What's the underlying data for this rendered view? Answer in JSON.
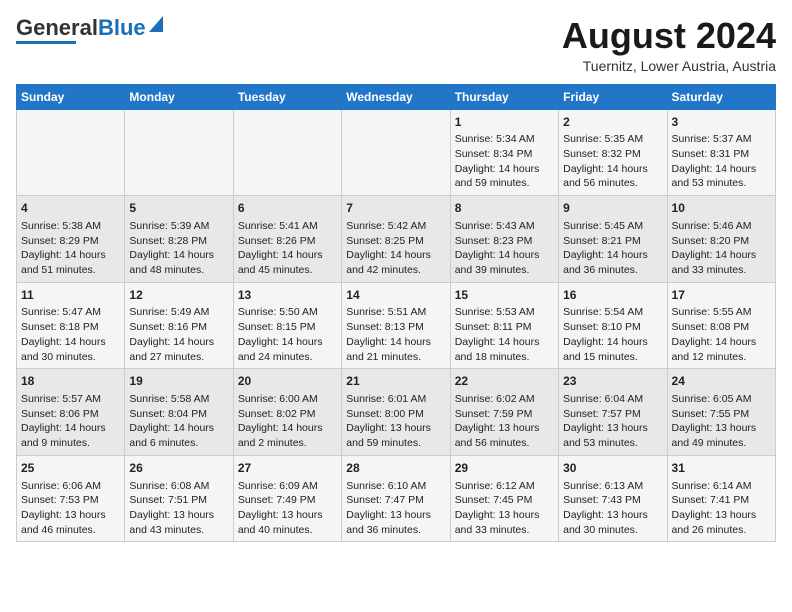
{
  "logo": {
    "part1": "General",
    "part2": "Blue"
  },
  "title": "August 2024",
  "subtitle": "Tuernitz, Lower Austria, Austria",
  "days_of_week": [
    "Sunday",
    "Monday",
    "Tuesday",
    "Wednesday",
    "Thursday",
    "Friday",
    "Saturday"
  ],
  "weeks": [
    [
      {
        "day": "",
        "info": ""
      },
      {
        "day": "",
        "info": ""
      },
      {
        "day": "",
        "info": ""
      },
      {
        "day": "",
        "info": ""
      },
      {
        "day": "1",
        "info": "Sunrise: 5:34 AM\nSunset: 8:34 PM\nDaylight: 14 hours and 59 minutes."
      },
      {
        "day": "2",
        "info": "Sunrise: 5:35 AM\nSunset: 8:32 PM\nDaylight: 14 hours and 56 minutes."
      },
      {
        "day": "3",
        "info": "Sunrise: 5:37 AM\nSunset: 8:31 PM\nDaylight: 14 hours and 53 minutes."
      }
    ],
    [
      {
        "day": "4",
        "info": "Sunrise: 5:38 AM\nSunset: 8:29 PM\nDaylight: 14 hours and 51 minutes."
      },
      {
        "day": "5",
        "info": "Sunrise: 5:39 AM\nSunset: 8:28 PM\nDaylight: 14 hours and 48 minutes."
      },
      {
        "day": "6",
        "info": "Sunrise: 5:41 AM\nSunset: 8:26 PM\nDaylight: 14 hours and 45 minutes."
      },
      {
        "day": "7",
        "info": "Sunrise: 5:42 AM\nSunset: 8:25 PM\nDaylight: 14 hours and 42 minutes."
      },
      {
        "day": "8",
        "info": "Sunrise: 5:43 AM\nSunset: 8:23 PM\nDaylight: 14 hours and 39 minutes."
      },
      {
        "day": "9",
        "info": "Sunrise: 5:45 AM\nSunset: 8:21 PM\nDaylight: 14 hours and 36 minutes."
      },
      {
        "day": "10",
        "info": "Sunrise: 5:46 AM\nSunset: 8:20 PM\nDaylight: 14 hours and 33 minutes."
      }
    ],
    [
      {
        "day": "11",
        "info": "Sunrise: 5:47 AM\nSunset: 8:18 PM\nDaylight: 14 hours and 30 minutes."
      },
      {
        "day": "12",
        "info": "Sunrise: 5:49 AM\nSunset: 8:16 PM\nDaylight: 14 hours and 27 minutes."
      },
      {
        "day": "13",
        "info": "Sunrise: 5:50 AM\nSunset: 8:15 PM\nDaylight: 14 hours and 24 minutes."
      },
      {
        "day": "14",
        "info": "Sunrise: 5:51 AM\nSunset: 8:13 PM\nDaylight: 14 hours and 21 minutes."
      },
      {
        "day": "15",
        "info": "Sunrise: 5:53 AM\nSunset: 8:11 PM\nDaylight: 14 hours and 18 minutes."
      },
      {
        "day": "16",
        "info": "Sunrise: 5:54 AM\nSunset: 8:10 PM\nDaylight: 14 hours and 15 minutes."
      },
      {
        "day": "17",
        "info": "Sunrise: 5:55 AM\nSunset: 8:08 PM\nDaylight: 14 hours and 12 minutes."
      }
    ],
    [
      {
        "day": "18",
        "info": "Sunrise: 5:57 AM\nSunset: 8:06 PM\nDaylight: 14 hours and 9 minutes."
      },
      {
        "day": "19",
        "info": "Sunrise: 5:58 AM\nSunset: 8:04 PM\nDaylight: 14 hours and 6 minutes."
      },
      {
        "day": "20",
        "info": "Sunrise: 6:00 AM\nSunset: 8:02 PM\nDaylight: 14 hours and 2 minutes."
      },
      {
        "day": "21",
        "info": "Sunrise: 6:01 AM\nSunset: 8:00 PM\nDaylight: 13 hours and 59 minutes."
      },
      {
        "day": "22",
        "info": "Sunrise: 6:02 AM\nSunset: 7:59 PM\nDaylight: 13 hours and 56 minutes."
      },
      {
        "day": "23",
        "info": "Sunrise: 6:04 AM\nSunset: 7:57 PM\nDaylight: 13 hours and 53 minutes."
      },
      {
        "day": "24",
        "info": "Sunrise: 6:05 AM\nSunset: 7:55 PM\nDaylight: 13 hours and 49 minutes."
      }
    ],
    [
      {
        "day": "25",
        "info": "Sunrise: 6:06 AM\nSunset: 7:53 PM\nDaylight: 13 hours and 46 minutes."
      },
      {
        "day": "26",
        "info": "Sunrise: 6:08 AM\nSunset: 7:51 PM\nDaylight: 13 hours and 43 minutes."
      },
      {
        "day": "27",
        "info": "Sunrise: 6:09 AM\nSunset: 7:49 PM\nDaylight: 13 hours and 40 minutes."
      },
      {
        "day": "28",
        "info": "Sunrise: 6:10 AM\nSunset: 7:47 PM\nDaylight: 13 hours and 36 minutes."
      },
      {
        "day": "29",
        "info": "Sunrise: 6:12 AM\nSunset: 7:45 PM\nDaylight: 13 hours and 33 minutes."
      },
      {
        "day": "30",
        "info": "Sunrise: 6:13 AM\nSunset: 7:43 PM\nDaylight: 13 hours and 30 minutes."
      },
      {
        "day": "31",
        "info": "Sunrise: 6:14 AM\nSunset: 7:41 PM\nDaylight: 13 hours and 26 minutes."
      }
    ]
  ]
}
